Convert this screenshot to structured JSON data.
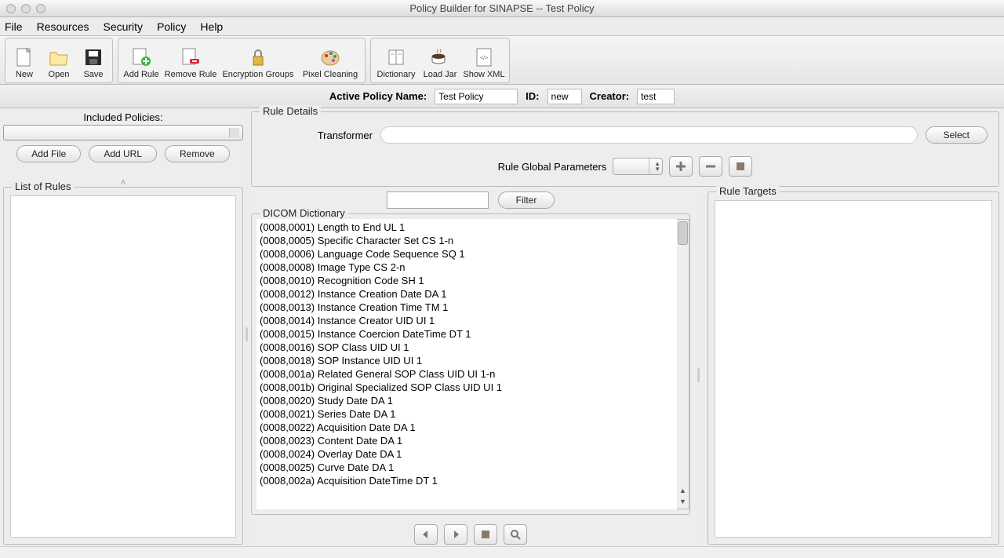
{
  "window": {
    "title": "Policy Builder for SINAPSE -- Test Policy"
  },
  "menu": {
    "file": "File",
    "resources": "Resources",
    "security": "Security",
    "policy": "Policy",
    "help": "Help"
  },
  "toolbar": {
    "new": "New",
    "open": "Open",
    "save": "Save",
    "add_rule": "Add Rule",
    "remove_rule": "Remove Rule",
    "encryption_groups": "Encryption Groups",
    "pixel_cleaning": "Pixel Cleaning",
    "dictionary": "Dictionary",
    "load_jar": "Load Jar",
    "show_xml": "Show XML"
  },
  "infobar": {
    "policy_label": "Active Policy Name:",
    "policy_value": "Test Policy",
    "id_label": "ID:",
    "id_value": "new",
    "creator_label": "Creator:",
    "creator_value": "test"
  },
  "left": {
    "included_label": "Included Policies:",
    "add_file": "Add File",
    "add_url": "Add URL",
    "remove": "Remove",
    "list_rules_label": "List of Rules"
  },
  "details": {
    "legend": "Rule Details",
    "transformer_label": "Transformer",
    "select_btn": "Select",
    "params_label": "Rule Global Parameters",
    "filter_btn": "Filter",
    "dict_legend": "DICOM Dictionary",
    "targets_legend": "Rule Targets"
  },
  "dict": [
    "(0008,0001) Length to End UL 1",
    "(0008,0005) Specific Character Set CS 1-n",
    "(0008,0006) Language Code Sequence SQ 1",
    "(0008,0008) Image Type CS 2-n",
    "(0008,0010) Recognition Code SH 1",
    "(0008,0012) Instance Creation Date DA 1",
    "(0008,0013) Instance Creation Time TM 1",
    "(0008,0014) Instance Creator UID UI 1",
    "(0008,0015) Instance Coercion DateTime DT 1",
    "(0008,0016) SOP Class UID UI 1",
    "(0008,0018) SOP Instance UID UI 1",
    "(0008,001a) Related General SOP Class UID UI 1-n",
    "(0008,001b) Original Specialized SOP Class UID UI 1",
    "(0008,0020) Study Date DA 1",
    "(0008,0021) Series Date DA 1",
    "(0008,0022) Acquisition Date DA 1",
    "(0008,0023) Content Date DA 1",
    "(0008,0024) Overlay Date DA 1",
    "(0008,0025) Curve Date DA 1",
    "(0008,002a) Acquisition DateTime DT 1"
  ]
}
